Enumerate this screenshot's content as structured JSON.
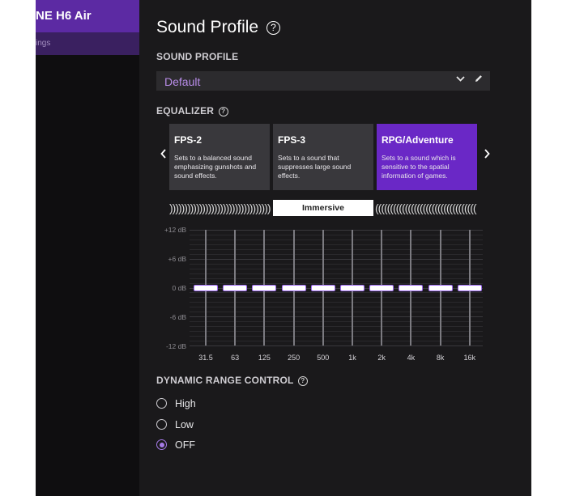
{
  "sidebar": {
    "device_name": "NE H6 Air",
    "device_subtitle": "ings"
  },
  "page": {
    "title": "Sound Profile"
  },
  "sound_profile": {
    "label": "SOUND PROFILE",
    "selected": "Default"
  },
  "equalizer": {
    "label": "EQUALIZER",
    "presets": [
      {
        "title": "FPS-2",
        "description": "Sets to a balanced sound emphasizing gunshots and sound effects.",
        "active": false
      },
      {
        "title": "FPS-3",
        "description": "Sets to a sound that suppresses large sound effects.",
        "active": false
      },
      {
        "title": "RPG/Adventure",
        "description": "Sets to a sound which is sensitive to the spatial information of games.",
        "active": true
      }
    ],
    "surround": "Immersive",
    "db_labels": [
      "+12 dB",
      "+6 dB",
      "0 dB",
      "-6 dB",
      "-12 dB"
    ],
    "bands": [
      {
        "freq": "31.5",
        "gain_db": 0
      },
      {
        "freq": "63",
        "gain_db": 0
      },
      {
        "freq": "125",
        "gain_db": 0
      },
      {
        "freq": "250",
        "gain_db": 0
      },
      {
        "freq": "500",
        "gain_db": 0
      },
      {
        "freq": "1k",
        "gain_db": 0
      },
      {
        "freq": "2k",
        "gain_db": 0
      },
      {
        "freq": "4k",
        "gain_db": 0
      },
      {
        "freq": "8k",
        "gain_db": 0
      },
      {
        "freq": "16k",
        "gain_db": 0
      }
    ]
  },
  "dynamic_range": {
    "label": "DYNAMIC RANGE CONTROL",
    "options": [
      {
        "label": "High",
        "checked": false
      },
      {
        "label": "Low",
        "checked": false
      },
      {
        "label": "OFF",
        "checked": true
      }
    ]
  },
  "icons": {
    "help": "?",
    "chevron_down": "⌄",
    "edit": "✎",
    "prev": "‹",
    "next": "›"
  },
  "colors": {
    "accent": "#6a28c6",
    "accent_light": "#b88ce8"
  }
}
